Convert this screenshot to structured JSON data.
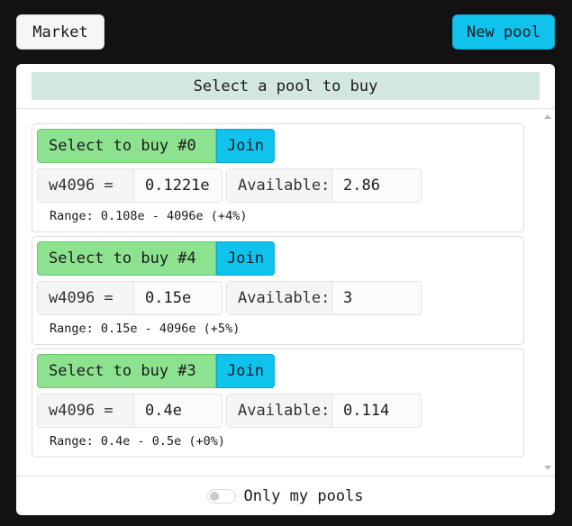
{
  "header": {
    "market_label": "Market",
    "new_pool_label": "New pool"
  },
  "panel": {
    "title": "Select a pool to buy"
  },
  "pools": [
    {
      "select_label": "Select to buy #0",
      "join_label": "Join",
      "weight_label": "w4096 =",
      "weight_value": "0.1221e",
      "available_label": "Available:",
      "available_value": "2.86",
      "range": "Range: 0.108e - 4096e (+4%)"
    },
    {
      "select_label": "Select to buy #4",
      "join_label": "Join",
      "weight_label": "w4096 =",
      "weight_value": "0.15e",
      "available_label": "Available:",
      "available_value": "3",
      "range": "Range: 0.15e - 4096e (+5%)"
    },
    {
      "select_label": "Select to buy #3",
      "join_label": "Join",
      "weight_label": "w4096 =",
      "weight_value": "0.4e",
      "available_label": "Available:",
      "available_value": "0.114",
      "range": "Range: 0.4e - 0.5e (+0%)"
    }
  ],
  "footer": {
    "only_my_pools_label": "Only my pools",
    "only_my_pools_checked": false
  },
  "colors": {
    "background": "#131112",
    "accent_cyan": "#10c3ec",
    "select_green": "#8de28f",
    "title_bar": "#d2e7df"
  }
}
